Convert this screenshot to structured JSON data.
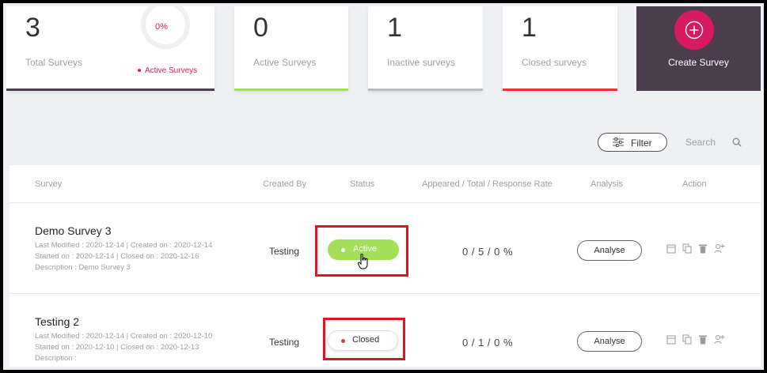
{
  "stats": {
    "total": {
      "value": "3",
      "label": "Total Surveys",
      "donut_pct": "0%",
      "legend": "Active Surveys"
    },
    "active": {
      "value": "0",
      "label": "Active Surveys",
      "accent": "#a3e05a"
    },
    "inactive": {
      "value": "1",
      "label": "Inactive surveys",
      "accent": "#b8bcc2"
    },
    "closed": {
      "value": "1",
      "label": "Closed surveys",
      "accent": "#e53935"
    },
    "create": {
      "label": "Create Survey",
      "accent": "#d81b60",
      "background": "#4b3d4d"
    }
  },
  "toolbar": {
    "filter_label": "Filter",
    "search_label": "Search"
  },
  "table": {
    "columns": [
      "Survey",
      "Created By",
      "Status",
      "Appeared / Total / Response Rate",
      "Analysis",
      "Action"
    ],
    "rows": [
      {
        "title": "Demo Survey 3",
        "modified": "Last Modified : 2020-12-14 | Created on : 2020-12-14",
        "dates": "Started on : 2020-12-14 | Closed on : 2020-12-16",
        "description": "Description : Demo Survey 3",
        "created_by": "Testing",
        "status": "Active",
        "rate": "0 / 5 / 0 %",
        "analysis": "Analyse"
      },
      {
        "title": "Testing 2",
        "modified": "Last Modified : 2020-12-14 | Created on : 2020-12-10",
        "dates": "Started on : 2020-12-10 | Closed on : 2020-12-13",
        "description": "Description :",
        "created_by": "Testing",
        "status": "Closed",
        "rate": "0 / 1 / 0 %",
        "analysis": "Analyse"
      }
    ],
    "action_icons": [
      "calendar-icon",
      "copy-icon",
      "trash-icon",
      "assign-user-icon"
    ]
  }
}
